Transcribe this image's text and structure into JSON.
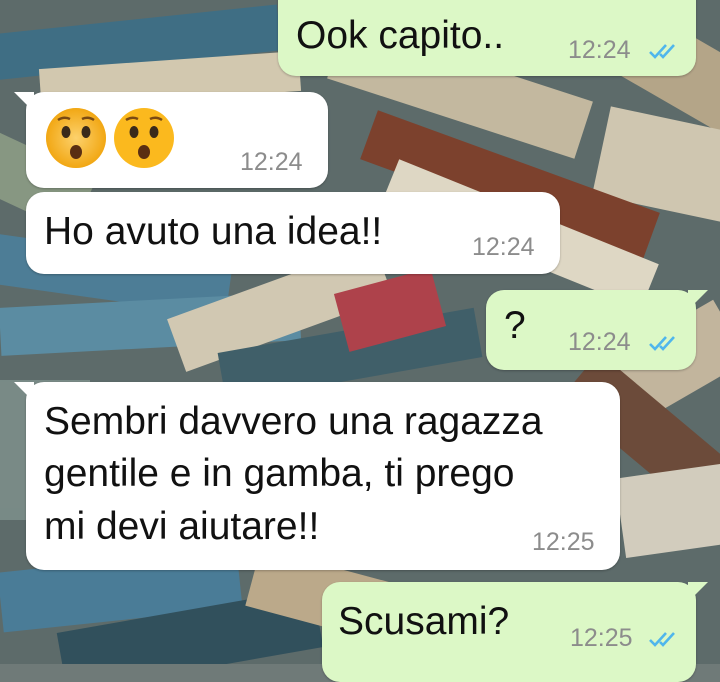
{
  "theme": {
    "outgoing_bubble": "#dcf8c6",
    "incoming_bubble": "#ffffff",
    "tick_color": "#4fb6ec",
    "time_color": "#8c8c8c"
  },
  "messages": [
    {
      "direction": "outgoing",
      "text": "Ook capito..",
      "time": "12:24",
      "status": "read-double-check-icon"
    },
    {
      "direction": "incoming",
      "emoji": [
        "hushed-face-emoji",
        "hushed-face-emoji"
      ],
      "time": "12:24"
    },
    {
      "direction": "incoming",
      "text": "Ho avuto una idea!!",
      "time": "12:24"
    },
    {
      "direction": "outgoing",
      "text": "?",
      "time": "12:24",
      "status": "read-double-check-icon"
    },
    {
      "direction": "incoming",
      "lines": [
        "Sembri davvero una ragazza",
        "gentile e in gamba, ti prego",
        "mi devi aiutare!!"
      ],
      "time": "12:25"
    },
    {
      "direction": "outgoing",
      "text": "Scusami?",
      "time": "12:25",
      "status": "read-double-check-icon"
    }
  ]
}
